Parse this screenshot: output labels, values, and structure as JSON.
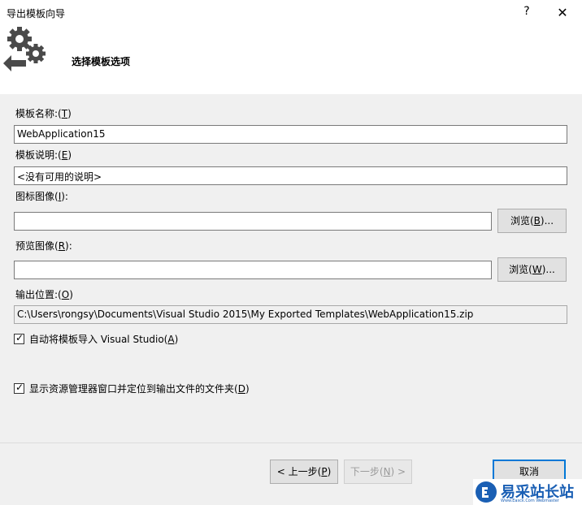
{
  "window": {
    "title": "导出模板向导",
    "help_glyph": "?",
    "close_glyph": "✕"
  },
  "header": {
    "title": "选择模板选项",
    "icon": "gears-export-icon"
  },
  "fields": {
    "template_name": {
      "label": "模板名称:(",
      "mnemonic": "T",
      "label_end": ")",
      "value": "WebApplication15"
    },
    "template_desc": {
      "label": "模板说明:(",
      "mnemonic": "E",
      "label_end": ")",
      "value": "<没有可用的说明>"
    },
    "icon_image": {
      "label": "图标图像(",
      "mnemonic": "I",
      "label_end": "):",
      "value": "",
      "browse": "浏览(",
      "browse_key": "B",
      "browse_end": ")..."
    },
    "preview_image": {
      "label": "预览图像(",
      "mnemonic": "R",
      "label_end": "):",
      "value": "",
      "browse": "浏览(",
      "browse_key": "W",
      "browse_end": ")..."
    },
    "output_location": {
      "label": "输出位置:(",
      "mnemonic": "O",
      "label_end": ")",
      "value": "C:\\Users\\rongsy\\Documents\\Visual Studio 2015\\My Exported Templates\\WebApplication15.zip"
    }
  },
  "options": {
    "auto_import": {
      "label": "自动将模板导入 Visual Studio(",
      "mnemonic": "A",
      "label_end": ")",
      "checked": true
    },
    "show_explorer": {
      "label": "显示资源管理器窗口并定位到输出文件的文件夹(",
      "mnemonic": "D",
      "label_end": ")",
      "checked": true
    }
  },
  "buttons": {
    "prev": {
      "label": "< 上一步(",
      "key": "P",
      "end": ")"
    },
    "next": {
      "label": "下一步(",
      "key": "N",
      "end": ") >"
    },
    "cancel": "取消"
  },
  "watermark": {
    "text": "易采站长站",
    "sub": "Www.Easck.Com Webmaster"
  }
}
